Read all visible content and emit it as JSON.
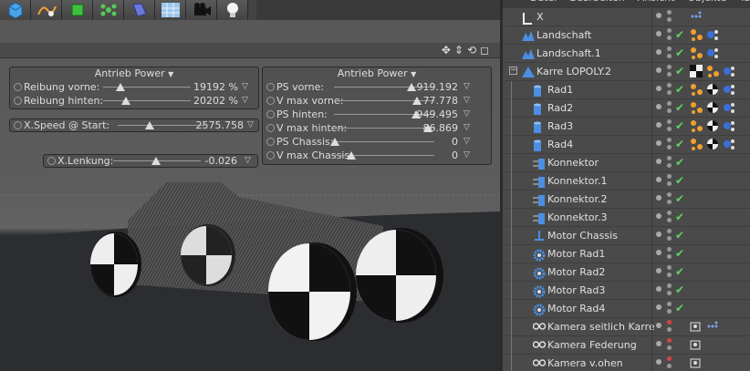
{
  "toolbar": {
    "buttons": [
      "cube-icon",
      "spline-pen-icon",
      "nurbs-icon",
      "array-icon",
      "deformer-icon",
      "floor-grid-icon",
      "camera-icon",
      "light-bulb-icon"
    ]
  },
  "panel_left": {
    "title": "Antrieb Power",
    "rows": [
      {
        "label": "Reibung vorne:",
        "value": "19192 %",
        "pos": 0.15
      },
      {
        "label": "Reibung hinten:",
        "value": "20202 %",
        "pos": 0.16
      }
    ]
  },
  "panel_right": {
    "title": "Antrieb Power",
    "rows": [
      {
        "label": "PS vorne:",
        "value": "919.192",
        "pos": 0.92
      },
      {
        "label": "V max vorne:",
        "value": "77.778",
        "pos": 0.78
      },
      {
        "label": "PS hinten:",
        "value": "949.495",
        "pos": 0.95
      },
      {
        "label": "V max hinten:",
        "value": "86.869",
        "pos": 0.87
      },
      {
        "label": "PS Chassis:",
        "value": "0",
        "pos": 0.0
      },
      {
        "label": "V max Chassis:",
        "value": "0",
        "pos": 0.0
      }
    ]
  },
  "xspeed": {
    "label": "X.Speed @ Start:",
    "value": "2575.758",
    "pos": 0.26
  },
  "xlenkung": {
    "label": "X.Lenkung:",
    "value": "-0.026",
    "pos": 0.49
  },
  "om": {
    "menu": [
      "Datei",
      "Bearbeiten",
      "Ansicht",
      "Objekte",
      "Tags"
    ],
    "rows": [
      {
        "name": "X",
        "icon": "null-icon",
        "indent": 1,
        "check": false
      },
      {
        "name": "Landschaft",
        "icon": "landscape-icon",
        "indent": 1,
        "check": true
      },
      {
        "name": "Landschaft.1",
        "icon": "landscape-icon",
        "indent": 1,
        "check": true
      },
      {
        "name": "Karre LOPOLY.2",
        "icon": "polygon-object-icon",
        "indent": 1,
        "check": true
      },
      {
        "name": "Rad1",
        "icon": "cylinder-icon",
        "indent": 2,
        "check": true
      },
      {
        "name": "Rad2",
        "icon": "cylinder-icon",
        "indent": 2,
        "check": true
      },
      {
        "name": "Rad3",
        "icon": "cylinder-icon",
        "indent": 2,
        "check": true
      },
      {
        "name": "Rad4",
        "icon": "cylinder-icon",
        "indent": 2,
        "check": true
      },
      {
        "name": "Konnektor",
        "icon": "connector-icon",
        "indent": 2,
        "check": true
      },
      {
        "name": "Konnektor.1",
        "icon": "connector-icon",
        "indent": 2,
        "check": true
      },
      {
        "name": "Konnektor.2",
        "icon": "connector-icon",
        "indent": 2,
        "check": true
      },
      {
        "name": "Konnektor.3",
        "icon": "connector-icon",
        "indent": 2,
        "check": true
      },
      {
        "name": "Motor Chassis",
        "icon": "motor-icon",
        "indent": 2,
        "check": true
      },
      {
        "name": "Motor Rad1",
        "icon": "gear-motor-icon",
        "indent": 2,
        "check": true
      },
      {
        "name": "Motor Rad2",
        "icon": "gear-motor-icon",
        "indent": 2,
        "check": true
      },
      {
        "name": "Motor Rad3",
        "icon": "gear-motor-icon",
        "indent": 2,
        "check": true
      },
      {
        "name": "Motor Rad4",
        "icon": "gear-motor-icon",
        "indent": 2,
        "check": true
      },
      {
        "name": "Kamera seitlich Karre",
        "icon": "camera-icon",
        "indent": 2,
        "check": false
      },
      {
        "name": "Kamera Federung",
        "icon": "camera-icon",
        "indent": 2,
        "check": false
      },
      {
        "name": "Kamera v.ohen",
        "icon": "camera-icon",
        "indent": 2,
        "check": false
      }
    ]
  },
  "colors": {
    "check": "#5fd35f",
    "accent_blue": "#4c8ee0"
  }
}
